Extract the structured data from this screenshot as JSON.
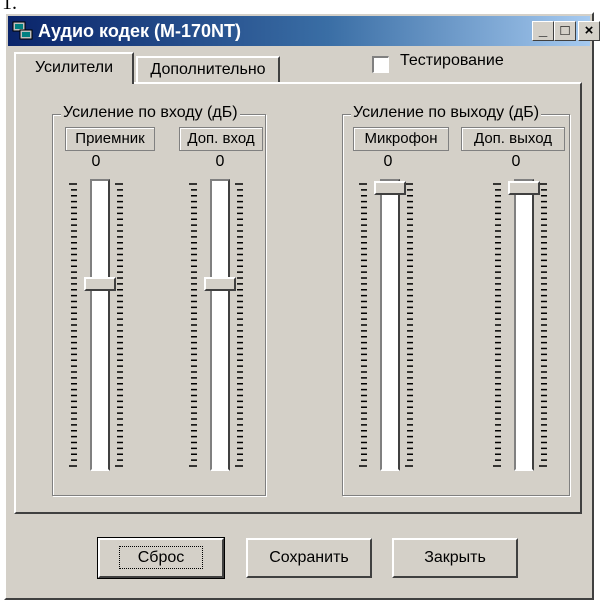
{
  "stray_text": "1.",
  "window": {
    "title": "Аудио кодек (M-170NT)",
    "icon": "app-network-icon",
    "controls": {
      "minimize": "_",
      "maximize": "□",
      "close": "×"
    }
  },
  "tabs": [
    {
      "label": "Усилители",
      "active": true
    },
    {
      "label": "Дополнительно",
      "active": false
    }
  ],
  "testing": {
    "label": "Тестирование",
    "checked": false
  },
  "groups": [
    {
      "title": "Усиление по входу (дБ)",
      "channels": [
        {
          "label": "Приемник",
          "value": "0",
          "level": 0.35
        },
        {
          "label": "Доп. вход",
          "value": "0",
          "level": 0.35
        }
      ]
    },
    {
      "title": "Усиление по выходу (дБ)",
      "channels": [
        {
          "label": "Микрофон",
          "value": "0",
          "level": 0.0
        },
        {
          "label": "Доп. выход",
          "value": "0",
          "level": 0.0
        }
      ]
    }
  ],
  "buttons": {
    "reset": "Сброс",
    "save": "Сохранить",
    "close": "Закрыть"
  }
}
